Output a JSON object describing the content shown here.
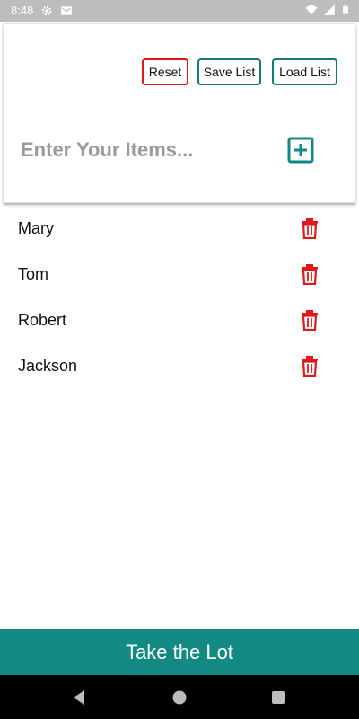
{
  "status_bar": {
    "time": "8:48"
  },
  "header": {
    "reset_label": "Reset",
    "save_label": "Save List",
    "load_label": "Load List",
    "input_placeholder": "Enter Your Items...",
    "input_value": ""
  },
  "items": [
    {
      "name": "Mary"
    },
    {
      "name": "Tom"
    },
    {
      "name": "Robert"
    },
    {
      "name": "Jackson"
    }
  ],
  "footer": {
    "take_label": "Take the Lot"
  },
  "colors": {
    "teal": "#138983",
    "red": "#e01818",
    "header_bg": "#ffffff",
    "status_bar": "#bdbdbd"
  },
  "icons": {
    "add": "plus-square-icon",
    "delete": "trash-icon",
    "status": [
      "settings-icon",
      "gmail-icon",
      "wifi-icon",
      "signal-icon",
      "battery-icon"
    ],
    "nav": [
      "back-icon",
      "home-icon",
      "recents-icon"
    ]
  }
}
